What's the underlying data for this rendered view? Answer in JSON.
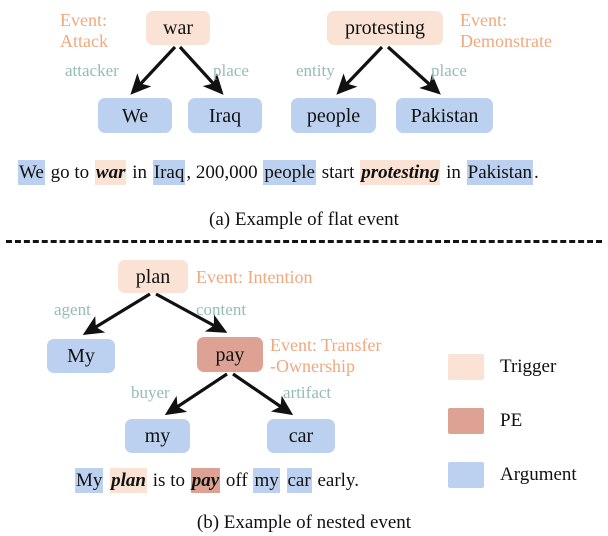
{
  "figure": {
    "panel_a": {
      "caption": "(a) Example of flat event",
      "events": [
        {
          "event_label": "Event:\nAttack",
          "trigger": "war",
          "edges": [
            {
              "role": "attacker",
              "argument": "We"
            },
            {
              "role": "place",
              "argument": "Iraq"
            }
          ]
        },
        {
          "event_label": "Event:\nDemonstrate",
          "trigger": "protesting",
          "edges": [
            {
              "role": "entity",
              "argument": "people"
            },
            {
              "role": "place",
              "argument": "Pakistan"
            }
          ]
        }
      ],
      "sentence": [
        {
          "text": "We",
          "type": "arg"
        },
        {
          "text": " go to ",
          "type": "plain"
        },
        {
          "text": "war",
          "type": "trigger"
        },
        {
          "text": " in ",
          "type": "plain"
        },
        {
          "text": "Iraq",
          "type": "arg"
        },
        {
          "text": ", 200,000 ",
          "type": "plain"
        },
        {
          "text": "people",
          "type": "arg"
        },
        {
          "text": " start ",
          "type": "plain"
        },
        {
          "text": "protesting",
          "type": "trigger"
        },
        {
          "text": " in ",
          "type": "plain"
        },
        {
          "text": "Pakistan",
          "type": "arg"
        },
        {
          "text": ".",
          "type": "plain"
        }
      ]
    },
    "panel_b": {
      "caption": "(b) Example of nested event",
      "events": [
        {
          "event_label": "Event: Intention",
          "trigger": "plan",
          "edges": [
            {
              "role": "agent",
              "argument": "My"
            },
            {
              "role": "content",
              "argument": "pay"
            }
          ]
        },
        {
          "event_label": "Event: Transfer\n-Ownership",
          "trigger": "pay",
          "edges": [
            {
              "role": "buyer",
              "argument": "my"
            },
            {
              "role": "artifact",
              "argument": "car"
            }
          ]
        }
      ],
      "sentence": [
        {
          "text": "My",
          "type": "arg"
        },
        {
          "text": " ",
          "type": "plain"
        },
        {
          "text": "plan",
          "type": "trigger"
        },
        {
          "text": " is to ",
          "type": "plain"
        },
        {
          "text": "pay",
          "type": "pe"
        },
        {
          "text": " off ",
          "type": "plain"
        },
        {
          "text": "my",
          "type": "arg"
        },
        {
          "text": " ",
          "type": "plain"
        },
        {
          "text": "car",
          "type": "arg"
        },
        {
          "text": " early.",
          "type": "plain"
        }
      ]
    },
    "legend": [
      {
        "label": "Trigger",
        "color": "#fae2d5"
      },
      {
        "label": "PE",
        "color": "#dda294"
      },
      {
        "label": "Argument",
        "color": "#bcd0ef"
      }
    ],
    "colors": {
      "trigger": "#fae2d5",
      "pe": "#dda294",
      "argument": "#bcd0ef",
      "role_label": "#93bdb4",
      "event_label": "#f0a87f",
      "arrow": "#111111"
    }
  }
}
